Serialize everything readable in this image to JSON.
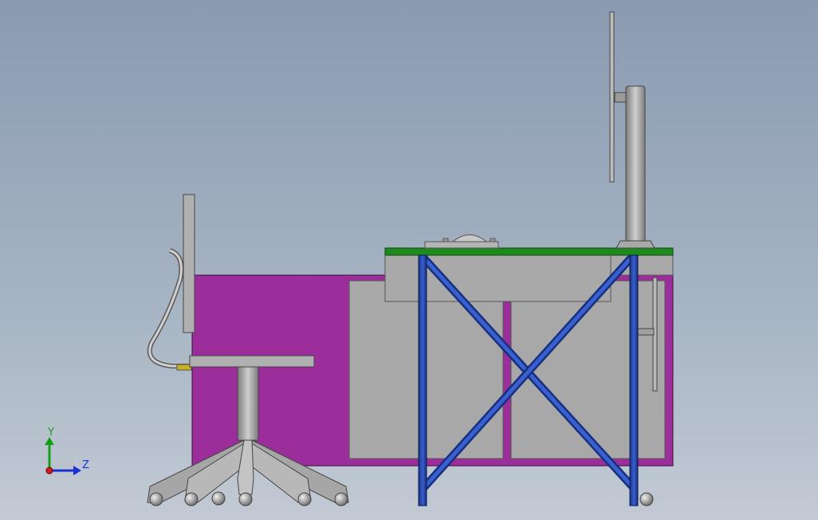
{
  "triad": {
    "y_label": "Y",
    "z_label": "Z",
    "y_color": "#14a014",
    "z_color": "#1c2fd0",
    "origin_color": "#d01c1c"
  },
  "colors": {
    "cabinet": "#9b2e9b",
    "panel": "#a8a8a8",
    "desktop_edge": "#1e8a1e",
    "frame": "#1f3fa0",
    "part_gray": "#a9a9a9"
  }
}
